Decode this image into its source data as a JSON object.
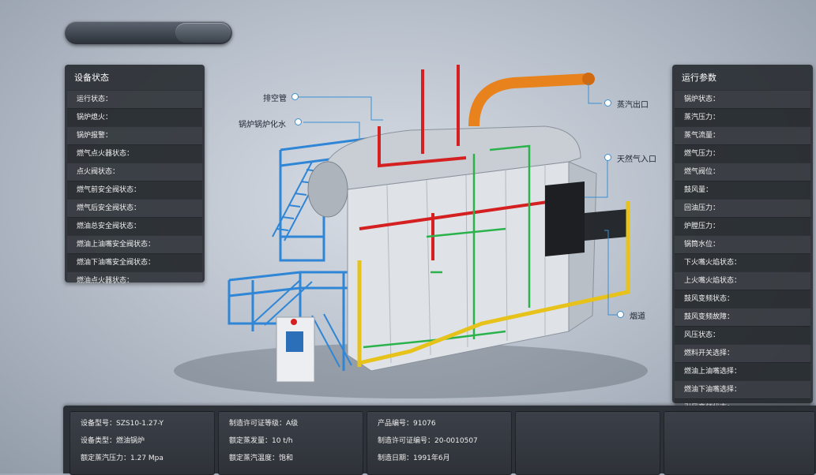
{
  "left_panel": {
    "title": "设备状态",
    "rows": [
      "运行状态：",
      "锅炉熄火：",
      "锅炉报警：",
      "燃气点火器状态：",
      "点火阀状态：",
      "燃气前安全阀状态：",
      "燃气后安全阀状态：",
      "燃油总安全阀状态：",
      "燃油上油嘴安全阀状态：",
      "燃油下油嘴安全阀状态：",
      "燃油点火器状态："
    ]
  },
  "right_panel": {
    "title": "运行参数",
    "rows": [
      "锅炉状态：",
      "蒸汽压力：",
      "蒸气流量：",
      "燃气压力：",
      "燃气阀位：",
      "鼓风量：",
      "回油压力：",
      "炉膛压力：",
      "锅筒水位：",
      "下火嘴火焰状态：",
      "上火嘴火焰状态：",
      "鼓风变频状态：",
      "鼓风变频故障：",
      "风压状态：",
      "燃料开关选择：",
      "燃油上油嘴选择：",
      "燃油下油嘴选择：",
      "引风变频状态："
    ]
  },
  "callouts": {
    "vent_pipe": "排空管",
    "chemical_water": "锅炉锅炉化水",
    "steam_outlet": "蒸汽出口",
    "gas_inlet": "天然气入口",
    "flue": "烟道"
  },
  "info": {
    "col1": [
      "设备型号：SZS10-1.27-Y",
      "设备类型：燃油锅炉",
      "额定蒸汽压力：1.27 Mpa"
    ],
    "col2": [
      "制造许可证等级：A级",
      "额定蒸发量：10 t/h",
      "额定蒸汽温度：饱和"
    ],
    "col3": [
      "产品编号：91076",
      "制造许可证编号：20-0010507",
      "制造日期：1991年6月"
    ]
  },
  "colors": {
    "accent": "#3b8fd1",
    "panel": "#2a2e34",
    "steam_pipe": "#e8821c",
    "red_pipe": "#d42020",
    "green_pipe": "#2bb24a",
    "blue_frame": "#2f86d6",
    "yellow_pipe": "#e6c21a"
  }
}
